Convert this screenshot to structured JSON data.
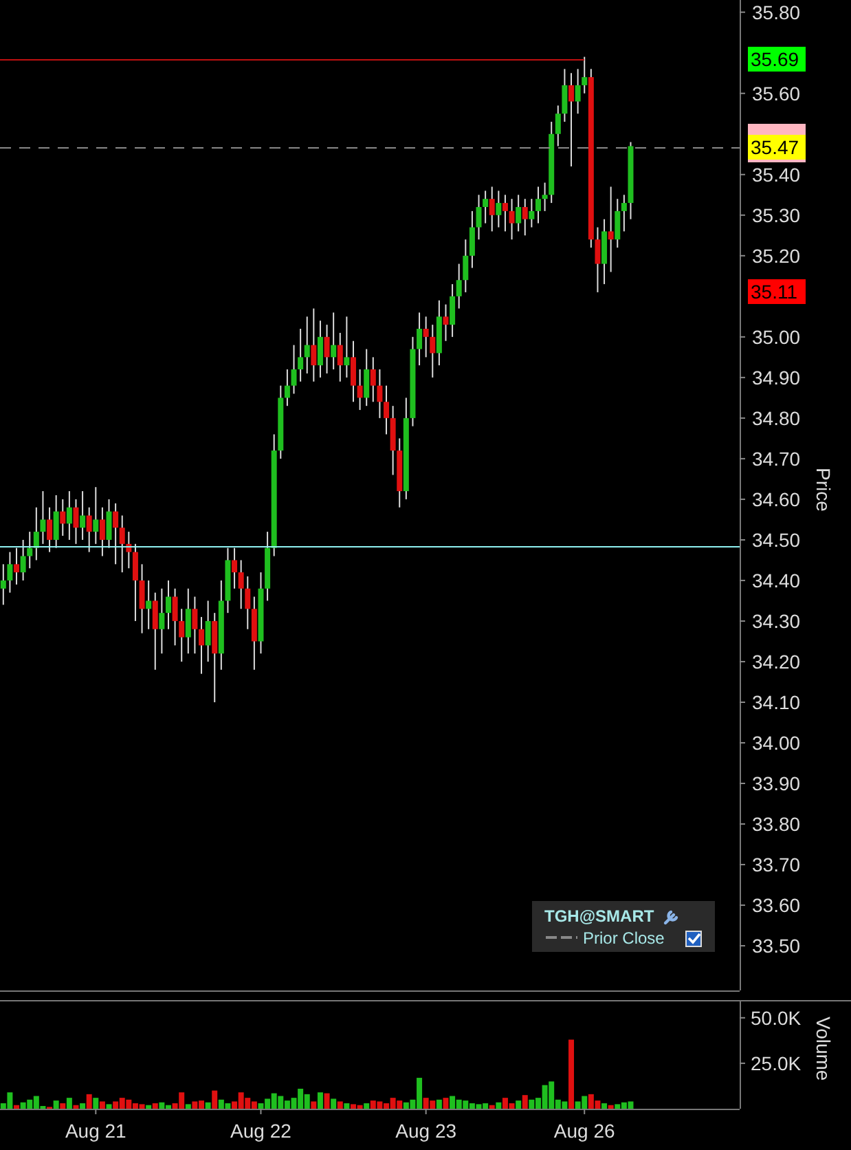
{
  "price_chart": {
    "chart_data": {
      "type": "candlestick",
      "ylabel": "Price",
      "ylim": [
        33.39,
        35.83
      ],
      "categories": [
        null,
        null,
        null,
        null,
        null,
        null,
        null,
        null,
        null,
        null,
        null,
        null,
        null,
        null,
        null,
        null,
        null,
        null,
        null,
        null,
        null,
        null,
        null,
        null,
        null,
        null,
        null,
        null,
        null,
        null,
        null,
        null,
        null,
        null,
        null,
        null,
        null,
        null,
        null,
        null,
        null,
        null,
        null,
        null,
        null,
        null,
        null,
        null,
        null,
        null,
        null,
        null,
        null,
        null,
        null,
        null,
        null,
        null,
        null,
        null,
        null,
        null,
        null,
        null,
        null,
        null,
        null,
        null,
        null,
        null,
        null,
        null,
        null,
        null,
        null,
        null,
        null,
        null,
        null,
        null,
        null,
        null,
        null,
        null,
        null,
        null,
        null,
        null,
        null,
        null,
        null,
        null,
        null,
        null,
        null,
        null,
        null,
        null,
        null,
        null,
        null,
        null,
        null,
        null,
        null,
        null,
        null,
        null,
        null,
        null,
        null,
        null
      ],
      "yticks": [
        {
          "value": 35.8,
          "label": "35.80"
        },
        {
          "value": 35.6,
          "label": "35.60"
        },
        {
          "value": 35.4,
          "label": "35.40"
        },
        {
          "value": 35.3,
          "label": "35.30"
        },
        {
          "value": 35.2,
          "label": "35.20"
        },
        {
          "value": 35.0,
          "label": "35.00"
        },
        {
          "value": 34.9,
          "label": "34.90"
        },
        {
          "value": 34.8,
          "label": "34.80"
        },
        {
          "value": 34.7,
          "label": "34.70"
        },
        {
          "value": 34.6,
          "label": "34.60"
        },
        {
          "value": 34.5,
          "label": "34.50"
        },
        {
          "value": 34.4,
          "label": "34.40"
        },
        {
          "value": 34.3,
          "label": "34.30"
        },
        {
          "value": 34.2,
          "label": "34.20"
        },
        {
          "value": 34.1,
          "label": "34.10"
        },
        {
          "value": 34.0,
          "label": "34.00"
        },
        {
          "value": 33.9,
          "label": "33.90"
        },
        {
          "value": 33.8,
          "label": "33.80"
        },
        {
          "value": 33.7,
          "label": "33.70"
        },
        {
          "value": 33.6,
          "label": "33.60"
        },
        {
          "value": 33.5,
          "label": "33.50"
        }
      ],
      "ohlc": [
        [
          34.38,
          34.44,
          34.34,
          34.4
        ],
        [
          34.4,
          34.47,
          34.37,
          34.44
        ],
        [
          34.44,
          34.48,
          34.39,
          34.42
        ],
        [
          34.42,
          34.5,
          34.4,
          34.46
        ],
        [
          34.46,
          34.52,
          34.43,
          34.48
        ],
        [
          34.48,
          34.58,
          34.45,
          34.52
        ],
        [
          34.52,
          34.62,
          34.49,
          34.55
        ],
        [
          34.55,
          34.58,
          34.47,
          34.5
        ],
        [
          34.5,
          34.61,
          34.48,
          34.57
        ],
        [
          34.57,
          34.6,
          34.51,
          34.54
        ],
        [
          34.54,
          34.62,
          34.5,
          34.58
        ],
        [
          34.58,
          34.6,
          34.49,
          34.53
        ],
        [
          34.53,
          34.62,
          34.5,
          34.56
        ],
        [
          34.56,
          34.58,
          34.47,
          34.52
        ],
        [
          34.52,
          34.63,
          34.49,
          34.55
        ],
        [
          34.55,
          34.58,
          34.46,
          34.5
        ],
        [
          34.5,
          34.6,
          34.48,
          34.57
        ],
        [
          34.57,
          34.59,
          34.44,
          34.53
        ],
        [
          34.53,
          34.56,
          34.42,
          34.49
        ],
        [
          34.49,
          34.52,
          34.43,
          34.47
        ],
        [
          34.47,
          34.49,
          34.3,
          34.4
        ],
        [
          34.4,
          34.44,
          34.27,
          34.33
        ],
        [
          34.33,
          34.4,
          34.28,
          34.35
        ],
        [
          34.35,
          34.37,
          34.18,
          34.28
        ],
        [
          34.28,
          34.38,
          34.22,
          34.32
        ],
        [
          34.32,
          34.4,
          34.28,
          34.36
        ],
        [
          34.36,
          34.38,
          34.24,
          34.3
        ],
        [
          34.3,
          34.33,
          34.2,
          34.26
        ],
        [
          34.26,
          34.38,
          34.22,
          34.33
        ],
        [
          34.33,
          34.36,
          34.22,
          34.28
        ],
        [
          34.28,
          34.31,
          34.17,
          34.24
        ],
        [
          34.24,
          34.35,
          34.2,
          34.3
        ],
        [
          34.3,
          34.32,
          34.1,
          34.22
        ],
        [
          34.22,
          34.4,
          34.18,
          34.35
        ],
        [
          34.35,
          34.48,
          34.32,
          34.45
        ],
        [
          34.45,
          34.48,
          34.38,
          34.42
        ],
        [
          34.42,
          34.45,
          34.33,
          34.38
        ],
        [
          34.38,
          34.41,
          34.28,
          34.33
        ],
        [
          34.33,
          34.36,
          34.18,
          34.25
        ],
        [
          34.25,
          34.42,
          34.22,
          34.38
        ],
        [
          34.38,
          34.52,
          34.35,
          34.48
        ],
        [
          34.48,
          34.76,
          34.46,
          34.72
        ],
        [
          34.72,
          34.88,
          34.7,
          34.85
        ],
        [
          34.85,
          34.92,
          34.83,
          34.88
        ],
        [
          34.88,
          34.98,
          34.86,
          34.92
        ],
        [
          34.92,
          35.02,
          34.89,
          34.95
        ],
        [
          34.95,
          35.05,
          34.91,
          34.98
        ],
        [
          34.98,
          35.07,
          34.89,
          34.93
        ],
        [
          34.93,
          35.04,
          34.9,
          35.0
        ],
        [
          35.0,
          35.03,
          34.91,
          34.95
        ],
        [
          34.95,
          35.06,
          34.92,
          34.98
        ],
        [
          34.98,
          35.01,
          34.89,
          34.93
        ],
        [
          34.93,
          35.05,
          34.9,
          34.95
        ],
        [
          34.95,
          34.99,
          34.84,
          34.88
        ],
        [
          34.88,
          34.92,
          34.82,
          34.85
        ],
        [
          34.85,
          34.97,
          34.83,
          34.92
        ],
        [
          34.92,
          34.95,
          34.84,
          34.88
        ],
        [
          34.88,
          34.92,
          34.8,
          34.84
        ],
        [
          34.84,
          34.88,
          34.76,
          34.8
        ],
        [
          34.8,
          34.83,
          34.66,
          34.72
        ],
        [
          34.72,
          34.75,
          34.58,
          34.62
        ],
        [
          34.62,
          34.85,
          34.6,
          34.8
        ],
        [
          34.8,
          35.0,
          34.78,
          34.97
        ],
        [
          34.97,
          35.06,
          34.93,
          35.02
        ],
        [
          35.02,
          35.05,
          34.95,
          35.0
        ],
        [
          35.0,
          35.03,
          34.9,
          34.96
        ],
        [
          34.96,
          35.09,
          34.93,
          35.05
        ],
        [
          35.05,
          35.08,
          34.99,
          35.03
        ],
        [
          35.03,
          35.13,
          35.0,
          35.1
        ],
        [
          35.1,
          35.18,
          35.07,
          35.14
        ],
        [
          35.14,
          35.24,
          35.11,
          35.2
        ],
        [
          35.2,
          35.31,
          35.17,
          35.27
        ],
        [
          35.27,
          35.35,
          35.24,
          35.32
        ],
        [
          35.32,
          35.36,
          35.28,
          35.34
        ],
        [
          35.34,
          35.37,
          35.26,
          35.3
        ],
        [
          35.3,
          35.36,
          35.27,
          35.33
        ],
        [
          35.33,
          35.35,
          35.26,
          35.31
        ],
        [
          35.31,
          35.34,
          35.24,
          35.28
        ],
        [
          35.28,
          35.35,
          35.26,
          35.32
        ],
        [
          35.32,
          35.34,
          35.25,
          35.29
        ],
        [
          35.29,
          35.34,
          35.27,
          35.31
        ],
        [
          35.31,
          35.37,
          35.28,
          35.34
        ],
        [
          35.34,
          35.38,
          35.31,
          35.35
        ],
        [
          35.35,
          35.53,
          35.33,
          35.5
        ],
        [
          35.5,
          35.57,
          35.47,
          35.55
        ],
        [
          35.55,
          35.66,
          35.53,
          35.62
        ],
        [
          35.62,
          35.65,
          35.42,
          35.58
        ],
        [
          35.58,
          35.66,
          35.55,
          35.62
        ],
        [
          35.62,
          35.69,
          35.6,
          35.64
        ],
        [
          35.64,
          35.66,
          35.22,
          35.24
        ],
        [
          35.24,
          35.27,
          35.11,
          35.18
        ],
        [
          35.18,
          35.29,
          35.13,
          35.26
        ],
        [
          35.26,
          35.37,
          35.16,
          35.24
        ],
        [
          35.24,
          35.34,
          35.22,
          35.31
        ],
        [
          35.31,
          35.35,
          35.26,
          35.33
        ],
        [
          35.33,
          35.48,
          35.29,
          35.47
        ],
        null,
        null,
        null,
        null,
        null,
        null,
        null,
        null,
        null,
        null,
        null,
        null,
        null,
        null,
        null,
        null
      ]
    },
    "price_markers": [
      {
        "text": "35.69",
        "color": "#00ff00"
      },
      {
        "color": "#ffb6c1"
      },
      {
        "text": "35.47",
        "color": "#ffff00"
      },
      {
        "text": "35.11",
        "color": "#ff0000"
      }
    ],
    "legend": {
      "symbol": "TGH@SMART",
      "items": [
        {
          "label": "Prior Close",
          "checked": true
        }
      ]
    }
  },
  "volume_chart": {
    "chart_data": {
      "type": "bar",
      "ylabel": "Volume",
      "ylim": [
        0,
        59000
      ],
      "categories": [
        null,
        null,
        null,
        null,
        null,
        null,
        null,
        null,
        null,
        null,
        null,
        null,
        null,
        null,
        "Aug 21",
        null,
        null,
        null,
        null,
        null,
        null,
        null,
        null,
        null,
        null,
        null,
        null,
        null,
        null,
        null,
        null,
        null,
        null,
        null,
        null,
        null,
        null,
        null,
        null,
        "Aug 22",
        null,
        null,
        null,
        null,
        null,
        null,
        null,
        null,
        null,
        null,
        null,
        null,
        null,
        null,
        null,
        null,
        null,
        null,
        null,
        null,
        null,
        null,
        null,
        null,
        "Aug 23",
        null,
        null,
        null,
        null,
        null,
        null,
        null,
        null,
        null,
        null,
        null,
        null,
        null,
        null,
        null,
        null,
        null,
        null,
        null,
        null,
        null,
        null,
        null,
        "Aug 26",
        null,
        null,
        null,
        null,
        null,
        null,
        null,
        null,
        null,
        null,
        null,
        null,
        null,
        null,
        null,
        null,
        null,
        null,
        null,
        null,
        null,
        null,
        null
      ],
      "yticks": [
        {
          "value": 25000,
          "label": "25.0K"
        },
        {
          "value": 50000,
          "label": "50.0K"
        }
      ],
      "series": [
        {
          "color": "#1fbf1f",
          "values": [
            3000,
            9000,
            null,
            3500,
            5000,
            7000,
            1500,
            null,
            4500,
            null,
            6000,
            null,
            3000,
            null,
            6000,
            null,
            2500,
            null,
            null,
            null,
            null,
            null,
            2000,
            null,
            3500,
            2000,
            null,
            null,
            2500,
            null,
            null,
            3500,
            null,
            5000,
            3000,
            null,
            null,
            null,
            null,
            3000,
            5500,
            8500,
            7000,
            4500,
            6000,
            11000,
            8000,
            null,
            9000,
            null,
            5500,
            null,
            3000,
            null,
            null,
            3000,
            null,
            null,
            null,
            null,
            null,
            3500,
            5000,
            17000,
            null,
            null,
            5000,
            null,
            7000,
            5000,
            4500,
            3000,
            2500,
            3000,
            null,
            3500,
            null,
            null,
            4500,
            null,
            5000,
            6000,
            13000,
            15000,
            5000,
            4000,
            null,
            4000,
            7000,
            null,
            null,
            3000,
            null,
            2500,
            3500,
            4000,
            null,
            null,
            null,
            null,
            null,
            null,
            null,
            null,
            null,
            null,
            null,
            null,
            null,
            null,
            null,
            null
          ]
        },
        {
          "color": "#e01010",
          "values": [
            null,
            null,
            2000,
            null,
            null,
            null,
            null,
            1000,
            null,
            3000,
            null,
            2000,
            null,
            8000,
            null,
            4000,
            null,
            4000,
            6000,
            5000,
            3000,
            2500,
            null,
            3000,
            null,
            null,
            3000,
            9000,
            null,
            4000,
            4500,
            null,
            10000,
            null,
            null,
            4000,
            9000,
            6000,
            4000,
            null,
            null,
            null,
            null,
            null,
            null,
            null,
            null,
            4000,
            null,
            8500,
            null,
            4000,
            null,
            2500,
            2000,
            null,
            4500,
            4000,
            3000,
            6000,
            4500,
            null,
            null,
            null,
            6000,
            4500,
            null,
            6000,
            null,
            null,
            null,
            null,
            null,
            null,
            2000,
            null,
            6000,
            3000,
            null,
            7500,
            null,
            null,
            null,
            null,
            null,
            null,
            38000,
            null,
            null,
            8000,
            4500,
            null,
            2000,
            null,
            null,
            null,
            null,
            null,
            null,
            null,
            null,
            null,
            null,
            null,
            null,
            null,
            null,
            null,
            null,
            null,
            null,
            null
          ]
        }
      ]
    }
  }
}
